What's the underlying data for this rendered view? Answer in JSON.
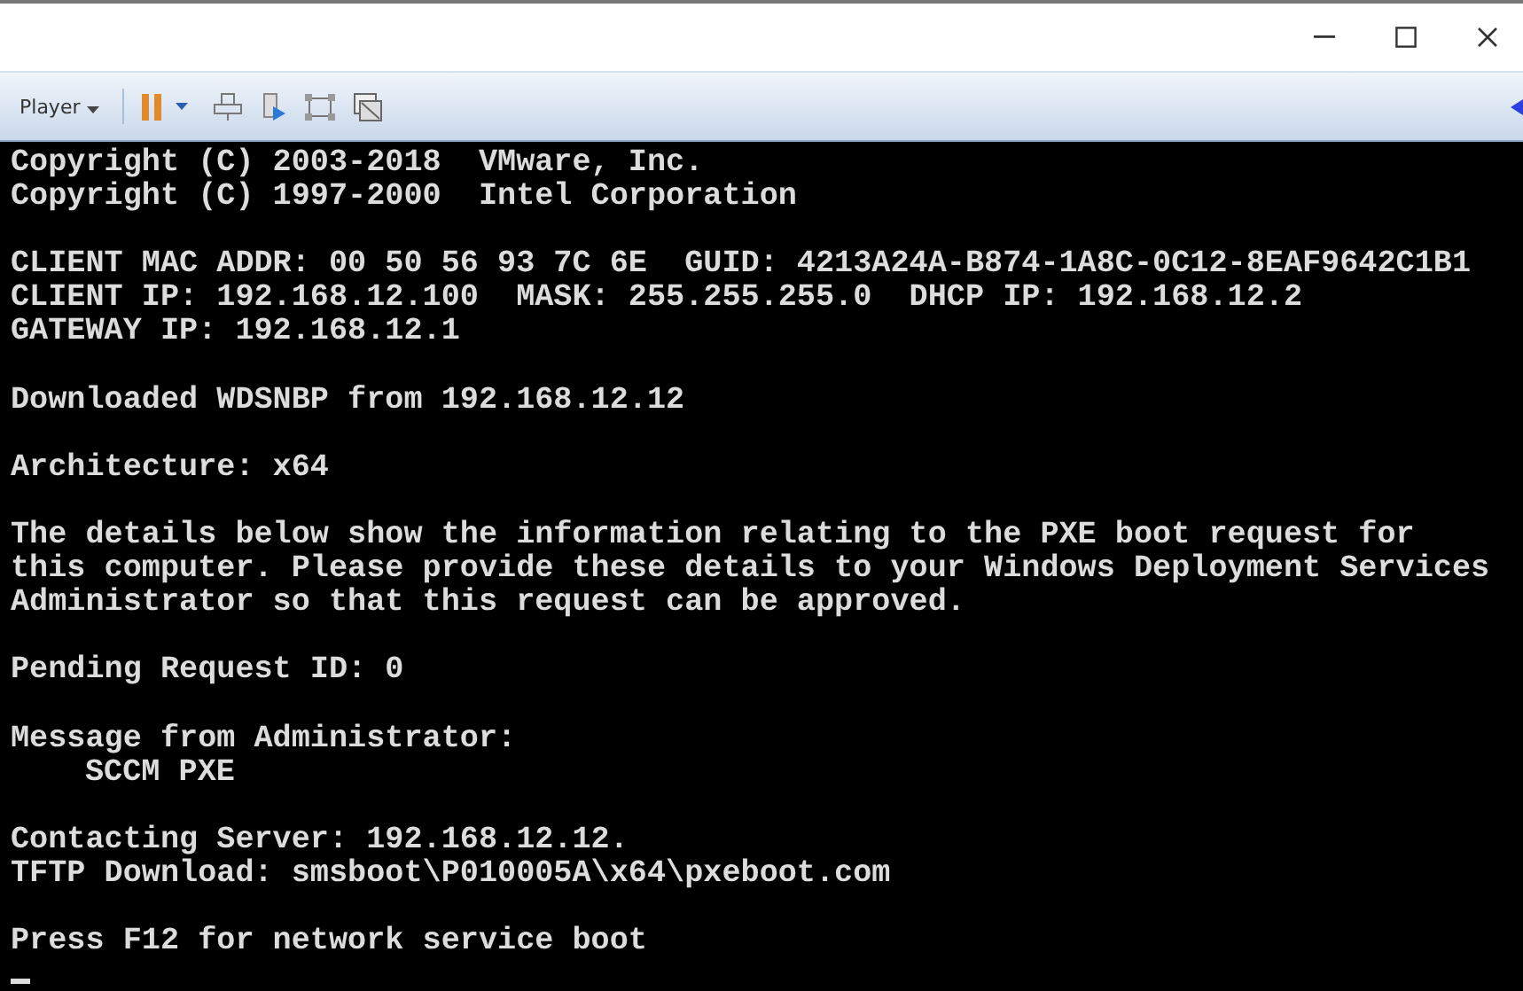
{
  "toolbar": {
    "player_menu": "Player"
  },
  "console": {
    "blocks": [
      [
        "Copyright (C) 2003-2018  VMware, Inc.",
        "Copyright (C) 1997-2000  Intel Corporation"
      ],
      [
        "CLIENT MAC ADDR: 00 50 56 93 7C 6E  GUID: 4213A24A-B874-1A8C-0C12-8EAF9642C1B1",
        "CLIENT IP: 192.168.12.100  MASK: 255.255.255.0  DHCP IP: 192.168.12.2",
        "GATEWAY IP: 192.168.12.1"
      ],
      [
        "Downloaded WDSNBP from 192.168.12.12"
      ],
      [
        "Architecture: x64"
      ],
      [
        "The details below show the information relating to the PXE boot request for",
        "this computer. Please provide these details to your Windows Deployment Services",
        "Administrator so that this request can be approved."
      ],
      [
        "Pending Request ID: 0"
      ],
      [
        "Message from Administrator:",
        {
          "text": "SCCM PXE",
          "indent": true
        }
      ],
      [
        "Contacting Server: 192.168.12.12.",
        "TFTP Download: smsboot\\P010005A\\x64\\pxeboot.com"
      ],
      [
        "Press F12 for network service boot"
      ]
    ]
  }
}
